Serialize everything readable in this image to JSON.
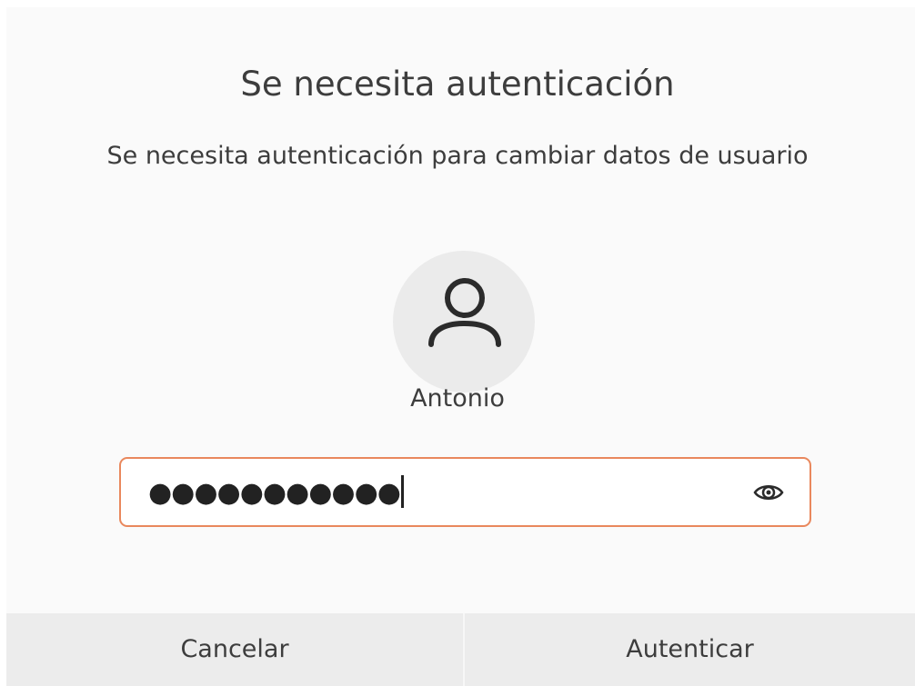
{
  "dialog": {
    "title": "Se necesita autenticación",
    "message": "Se necesita autenticación para cambiar datos de usuario",
    "user": {
      "name": "Antonio",
      "avatar_icon": "user-avatar-icon"
    },
    "password": {
      "masked_value": "●●●●●●●●●●●",
      "reveal_icon": "eye-icon"
    },
    "buttons": {
      "cancel_label": "Cancelar",
      "authenticate_label": "Autenticar"
    }
  },
  "colors": {
    "accent": "#e9885d",
    "background": "#fafafa",
    "button_bar": "#ececec",
    "text": "#3d3d3d"
  }
}
